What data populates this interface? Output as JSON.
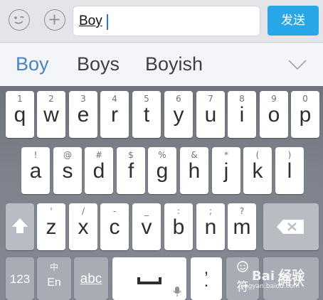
{
  "input_bar": {
    "emoji_icon": "smiley-face-icon",
    "plus_icon": "plus-icon",
    "text_value": "Boy",
    "send_label": "发送",
    "send_color": "#27a7e7"
  },
  "candidates": {
    "items": [
      "Boy",
      "Boys",
      "Boyish"
    ],
    "highlight_color": "#4a82c4",
    "expand_icon": "chevron-down-icon"
  },
  "keyboard": {
    "row1": [
      {
        "main": "q",
        "sub": "1"
      },
      {
        "main": "w",
        "sub": "2"
      },
      {
        "main": "e",
        "sub": "3"
      },
      {
        "main": "r",
        "sub": "4"
      },
      {
        "main": "t",
        "sub": "5"
      },
      {
        "main": "y",
        "sub": "6"
      },
      {
        "main": "u",
        "sub": "7"
      },
      {
        "main": "i",
        "sub": "8"
      },
      {
        "main": "o",
        "sub": "9"
      },
      {
        "main": "p",
        "sub": "0"
      }
    ],
    "row2": [
      {
        "main": "a",
        "sub": "!"
      },
      {
        "main": "s",
        "sub": "@"
      },
      {
        "main": "d",
        "sub": "#"
      },
      {
        "main": "f",
        "sub": "$"
      },
      {
        "main": "g",
        "sub": "%"
      },
      {
        "main": "h",
        "sub": "&"
      },
      {
        "main": "j",
        "sub": "*"
      },
      {
        "main": "k",
        "sub": "("
      },
      {
        "main": "l",
        "sub": ")"
      }
    ],
    "row3": [
      {
        "main": "z",
        "sub": "'"
      },
      {
        "main": "x",
        "sub": "/"
      },
      {
        "main": "c",
        "sub": "-"
      },
      {
        "main": "v",
        "sub": "_"
      },
      {
        "main": "b",
        "sub": ":"
      },
      {
        "main": "n",
        "sub": ";"
      },
      {
        "main": "m",
        "sub": "?"
      }
    ],
    "shift_icon": "shift-arrow-icon",
    "backspace_icon": "backspace-icon",
    "row4": {
      "num_label": "123",
      "lang_top": "中",
      "lang_bottom": "En",
      "abc_label": "abc",
      "space_icon": "space-bar-icon",
      "mic_icon": "microphone-icon",
      "punct_top": ",",
      "punct_bottom": ".",
      "emoji_icon": "smiley-face-icon",
      "emoji_label": "符",
      "confirm_label": "确认"
    }
  },
  "watermark": {
    "text": "Bai 经验",
    "url": "jingyan.baidu.com"
  }
}
